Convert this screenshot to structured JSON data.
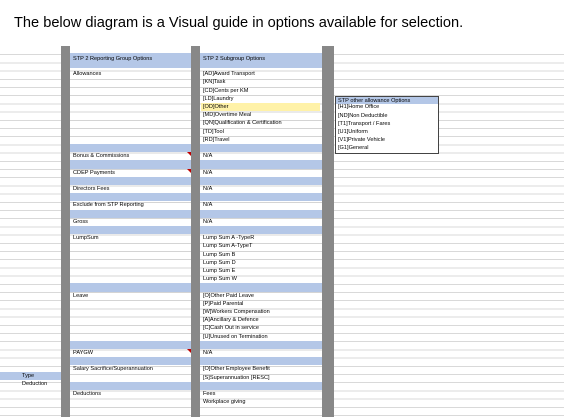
{
  "caption": "The below diagram is a Visual guide in options available for selection.",
  "headers": {
    "group": "STP 2 Reporting Group Options",
    "subgroup": "STP 2 Subgroup Options",
    "other": "STP other allowance Options"
  },
  "rows": {
    "allowances": "Allowances",
    "bonus": "Bonus & Commissions",
    "cdep": "CDEP Payments",
    "directors": "Directors Fees",
    "exclude": "Exclude from STP Reporting",
    "gross": "Gross",
    "lumpsum": "LumpSum",
    "leave": "Leave",
    "paygw": "PAYGW",
    "salary": "Salary Sacrifice/Superannuation",
    "deductions": "Deductions"
  },
  "subgroups": {
    "allowances": [
      "[AD]Award Transport",
      "[KN]Task",
      "[CD]Cents per KM",
      "[LD]Laundry",
      "[OD]Other",
      "[MD]Overtime Meal",
      "[QN]Qualification & Certification",
      "[TD]Tool",
      "[RD]Travel"
    ],
    "bonus": [
      "N/A"
    ],
    "cdep": [
      "N/A"
    ],
    "directors": [
      "N/A"
    ],
    "exclude": [
      "N/A"
    ],
    "gross": [
      "N/A"
    ],
    "lumpsum": [
      "Lump Sum A -TypeR",
      "Lump Sum A-TypeT",
      "Lump Sum B",
      "Lump Sum D",
      "Lump Sum E",
      "Lump Sum W"
    ],
    "leave": [
      "[O]Other Paid Leave",
      "[P]Paid Parental",
      "[W]Workers Compensation",
      "[A]Ancillary & Defence",
      "[C]Cash Out in service",
      "[U]Unused on Termination"
    ],
    "paygw": [
      "N/A"
    ],
    "salary": [
      "[O]Other Employee Benefit",
      "[S]Superannuation [RESC]"
    ],
    "deductions": [
      "Fees",
      "Workplace giving"
    ]
  },
  "highlighted_subgroup": "[OD]Other",
  "other_options": [
    "[H1]Home Office",
    "[ND]Non Deductible",
    "[T1]Transport / Fares",
    "[U1]Uniform",
    "[V1]Private Vehicle",
    "[G1]General"
  ],
  "type_column": {
    "header": "Type",
    "value": "Deduction"
  },
  "colors": {
    "header_fill": "#b4c7e7",
    "highlight_fill": "#fff2a8",
    "gutter": "#888888",
    "comment_marker": "#c00000"
  }
}
